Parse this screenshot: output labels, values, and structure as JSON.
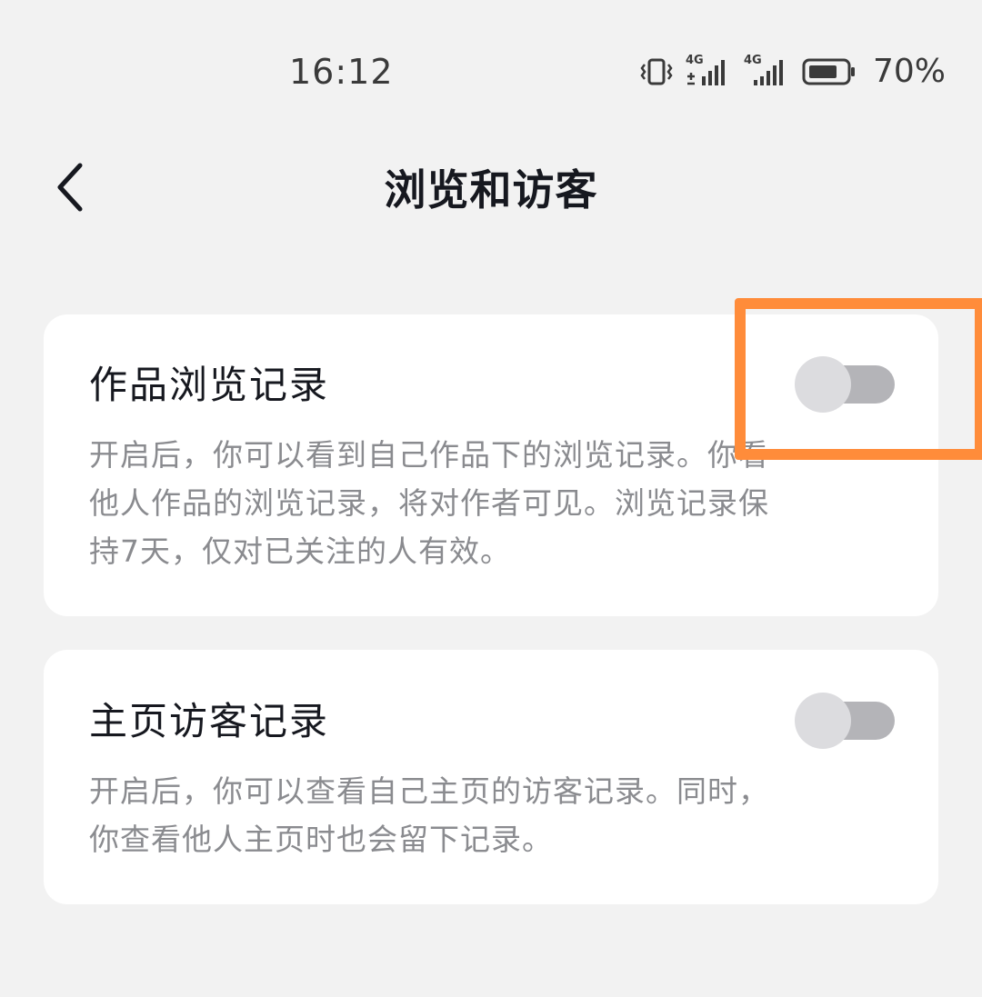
{
  "status_bar": {
    "time": "16:12",
    "icons": [
      "vibrate-icon",
      "signal-4g-icon",
      "signal-4g-icon",
      "battery-icon"
    ],
    "signal_labels": [
      "4G",
      "4G"
    ],
    "battery_percent": "70%"
  },
  "header": {
    "back_icon": "chevron-left-icon",
    "title": "浏览和访客"
  },
  "settings": [
    {
      "title": "作品浏览记录",
      "description_lines": [
        "开启后，你可以看到自己作品下的浏览记录。你看",
        "他人作品的浏览记录，将对作者可见。浏览记录保",
        "持7天，仅对已关注的人有效。"
      ],
      "enabled": false
    },
    {
      "title": "主页访客记录",
      "description_lines": [
        "开启后，你可以查看自己主页的访客记录。同时，",
        "你查看他人主页时也会留下记录。"
      ],
      "enabled": false
    }
  ],
  "colors": {
    "background": "#f2f2f2",
    "card": "#ffffff",
    "title_text": "#16181f",
    "description_text": "#8a8b8f",
    "toggle_track_off": "#b4b4b8",
    "toggle_knob_off": "#dcdcdf",
    "highlight": "#ff8c3a"
  }
}
